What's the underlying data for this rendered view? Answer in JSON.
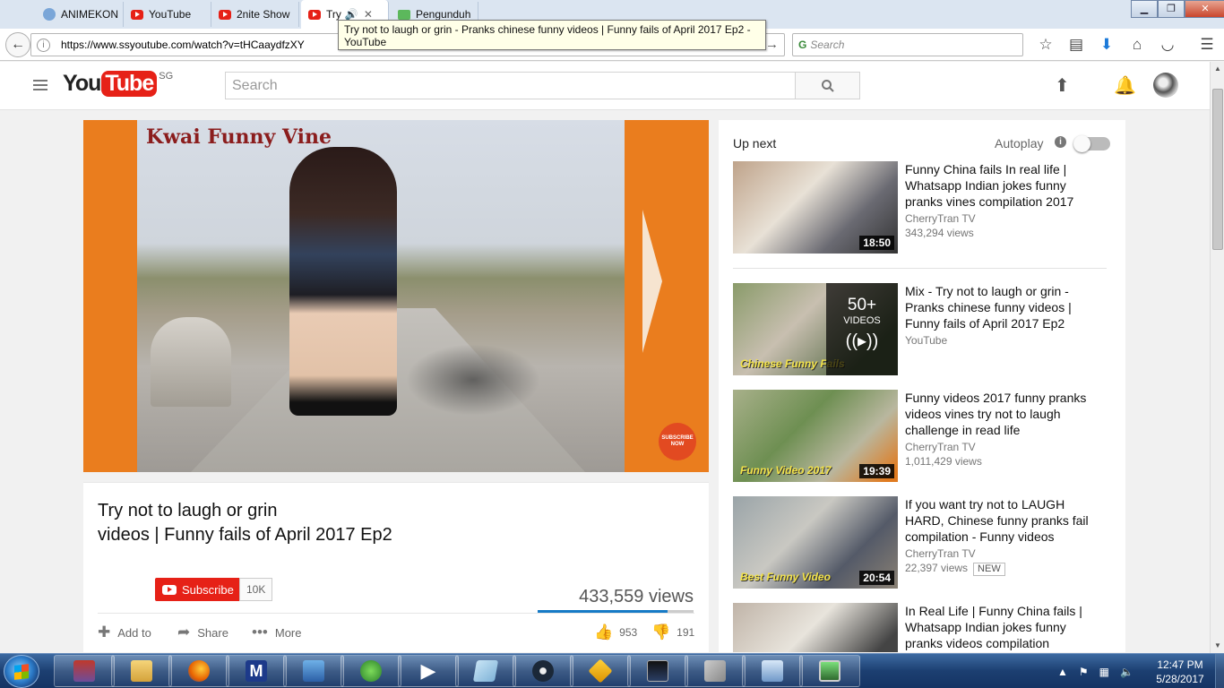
{
  "browser": {
    "tabs": [
      {
        "label": "ANIMEKON",
        "icon": "globe-icon"
      },
      {
        "label": "YouTube",
        "icon": "youtube-icon"
      },
      {
        "label": "2nite Show",
        "icon": "youtube-icon"
      },
      {
        "label": "Try",
        "icon": "youtube-icon",
        "active": true
      },
      {
        "label": "Pengunduh",
        "icon": "download-icon"
      }
    ],
    "url": "https://www.ssyoutube.com/watch?v=tHCaaydfzXY",
    "search_placeholder": "Search",
    "tooltip": "Try not to laugh or grin - Pranks chinese funny videos | Funny fails of April 2017 Ep2 - YouTube"
  },
  "youtube": {
    "region": "SG",
    "search_placeholder": "Search",
    "video_overlay_text": "Kwai Funny Vine",
    "video_subscribe_badge": "SUBSCRIBE NOW",
    "title_line1": "Try not to laugh or grin",
    "title_line2": "videos | Funny fails of April 2017 Ep2",
    "subscribe_label": "Subscribe",
    "subscriber_count": "10K",
    "views": "433,559 views",
    "like_ratio": 0.833,
    "actions": {
      "add_to": "Add to",
      "share": "Share",
      "more": "More"
    },
    "likes": "953",
    "dislikes": "191",
    "sidebar": {
      "up_next": "Up next",
      "autoplay": "Autoplay",
      "items": [
        {
          "title": "Funny China fails In real life | Whatsapp Indian jokes funny pranks vines compilation 2017",
          "channel": "CherryTran TV",
          "views": "343,294 views",
          "duration": "18:50"
        },
        {
          "title": "Mix - Try not to laugh or grin - Pranks chinese funny videos | Funny fails of April 2017 Ep2",
          "channel": "YouTube",
          "mix_count": "50+",
          "mix_label": "VIDEOS",
          "thumb_text": "Chinese Funny Fails"
        },
        {
          "title": "Funny videos 2017 funny pranks videos vines try not to laugh challenge in read life",
          "channel": "CherryTran TV",
          "views": "1,011,429 views",
          "duration": "19:39",
          "thumb_text": "Funny Video 2017"
        },
        {
          "title": "If you want try not to LAUGH HARD, Chinese funny pranks fail compilation - Funny videos",
          "channel": "CherryTran TV",
          "views": "22,397 views",
          "badge": "NEW",
          "duration": "20:54",
          "thumb_text": "Best Funny Video"
        },
        {
          "title": "In Real Life | Funny China fails | Whatsapp Indian jokes funny pranks videos compilation",
          "channel": "",
          "views": ""
        }
      ]
    }
  },
  "taskbar": {
    "time": "12:47 PM",
    "date": "5/28/2017"
  }
}
